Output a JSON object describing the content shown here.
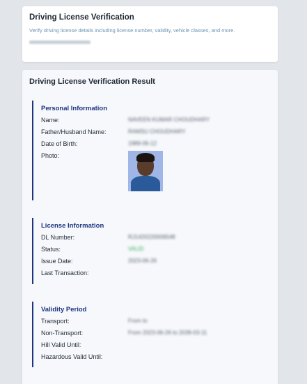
{
  "header_card": {
    "title": "Driving License Verification",
    "description": "Verify driving license details including license number, validity, vehicle classes, and more."
  },
  "result": {
    "title": "Driving License Verification Result",
    "personal": {
      "heading": "Personal Information",
      "name_label": "Name:",
      "name_value": "NAVEEN KUMAR CHOUDHARY",
      "father_label": "Father/Husband Name:",
      "father_value": "RAMSU CHOUDHARY",
      "dob_label": "Date of Birth:",
      "dob_value": "1989-06-12",
      "photo_label": "Photo:"
    },
    "license": {
      "heading": "License Information",
      "dl_label": "DL Number:",
      "dl_value": "RJ1420220006548",
      "status_label": "Status:",
      "status_value": "VALID",
      "issue_label": "Issue Date:",
      "issue_value": "2023-06-26",
      "last_label": "Last Transaction:"
    },
    "validity": {
      "heading": "Validity Period",
      "transport_label": "Transport:",
      "transport_value": "From to",
      "nontransport_label": "Non-Transport:",
      "nontransport_value": "From 2023-06-26 to 2039-03-11",
      "hill_label": "Hill Valid Until:",
      "hazardous_label": "Hazardous Valid Until:"
    }
  }
}
